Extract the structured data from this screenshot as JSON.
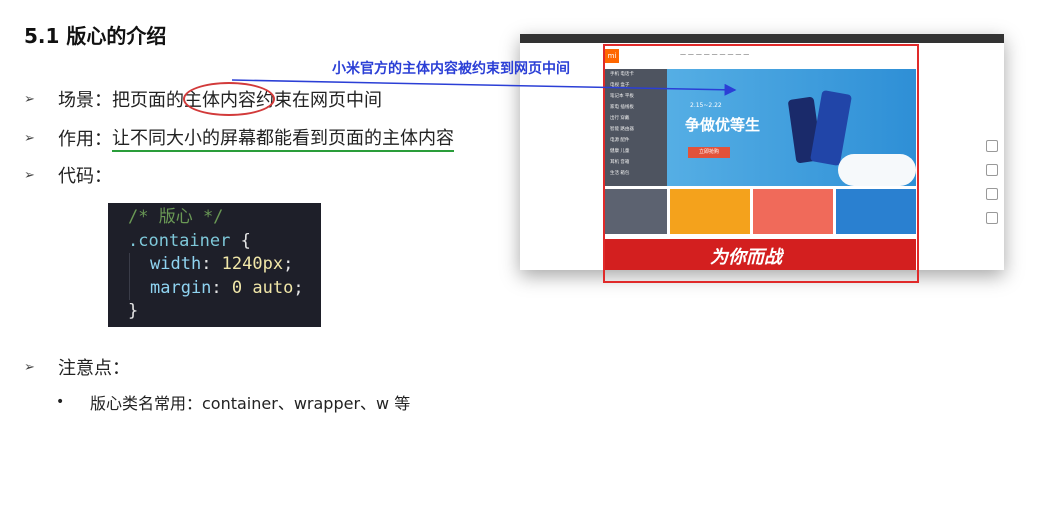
{
  "title": "5.1 版心的介绍",
  "bullets": {
    "scene": {
      "label": "场景：",
      "pre": "把页面的",
      "highlight": "主体内容",
      "post": "约束在网页中间"
    },
    "effect": {
      "label": "作用：",
      "text": "让不同大小的屏幕都能看到页面的主体内容"
    },
    "code": {
      "label": "代码："
    },
    "notes": {
      "label": "注意点：",
      "sub": "版心类名常用：container、wrapper、w 等"
    }
  },
  "code_block": {
    "comment": "/* 版心 */",
    "selector": ".container",
    "open": " {",
    "line1_prop": "width",
    "line1_val": " 1240px",
    "line2_prop": "margin",
    "line2_val": " 0 auto",
    "close": "}"
  },
  "callout": "小米官方的主体内容被约束到网页中间",
  "mini_page": {
    "logo": "mi",
    "slogan": "争做优等生",
    "dates": "2.15~2.22",
    "buy_button": "立即抢购",
    "banner_text": "为你而战",
    "menu": [
      "手机 电话卡",
      "电视 盒子",
      "笔记本 平板",
      "家电 插线板",
      "出行 穿戴",
      "智能 路由器",
      "电源 配件",
      "健康 儿童",
      "耳机 音箱",
      "生活 箱包"
    ]
  },
  "colors": {
    "accent_red": "#e02a2a",
    "callout_blue": "#2b3fd6",
    "underline_green": "#2a9d3a",
    "code_bg": "#1e1f29"
  }
}
